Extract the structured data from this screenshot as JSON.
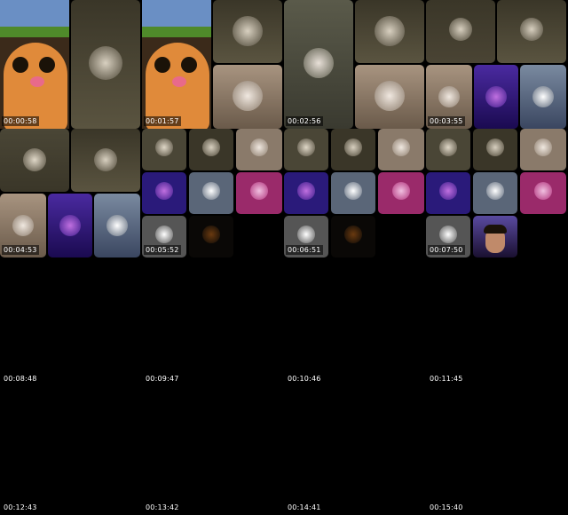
{
  "thumbnails": [
    {
      "timestamp": "00:00:58"
    },
    {
      "timestamp": "00:01:57"
    },
    {
      "timestamp": "00:02:56"
    },
    {
      "timestamp": "00:03:55"
    },
    {
      "timestamp": "00:04:53"
    },
    {
      "timestamp": "00:05:52"
    },
    {
      "timestamp": "00:06:51"
    },
    {
      "timestamp": "00:07:50"
    },
    {
      "timestamp": "00:08:48"
    },
    {
      "timestamp": "00:09:47"
    },
    {
      "timestamp": "00:10:46"
    },
    {
      "timestamp": "00:11:45"
    },
    {
      "timestamp": "00:12:43"
    },
    {
      "timestamp": "00:13:42"
    },
    {
      "timestamp": "00:14:41"
    },
    {
      "timestamp": "00:15:40"
    }
  ],
  "colors": {
    "background": "#000000",
    "olive_tile": "#4a4534",
    "beige_tile": "#8a7a6a",
    "purple_tile": "#3a1a8a",
    "steel_tile": "#5a6678",
    "pink_tile": "#b0307a",
    "gray_tile": "#555555",
    "mascot_orange": "#e08a3a"
  }
}
